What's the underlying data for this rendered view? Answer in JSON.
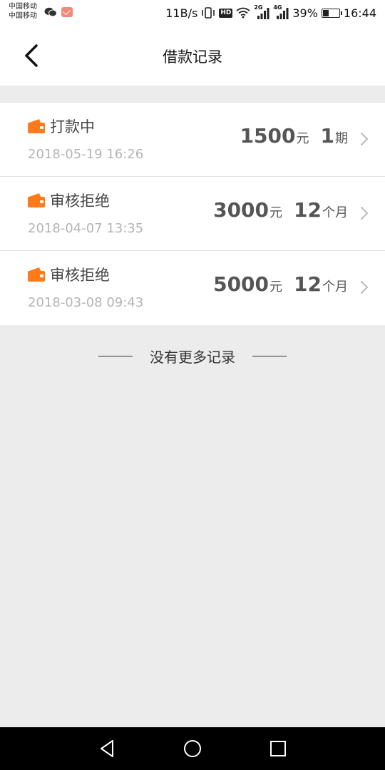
{
  "status_bar": {
    "carrier_1": "中国移动",
    "carrier_2": "中国移动",
    "speed": "11B/s",
    "hd": "HD",
    "net_2g": "2G",
    "net_4g": "4G",
    "battery_percent": "39%",
    "battery_level": 0.39,
    "time": "16:44"
  },
  "header": {
    "title": "借款记录"
  },
  "records": [
    {
      "status": "打款中",
      "date": "2018-05-19 16:26",
      "amount": "1500",
      "amount_unit": "元",
      "term": "1",
      "term_unit": "期"
    },
    {
      "status": "审核拒绝",
      "date": "2018-04-07 13:35",
      "amount": "3000",
      "amount_unit": "元",
      "term": "12",
      "term_unit": "个月"
    },
    {
      "status": "审核拒绝",
      "date": "2018-03-08 09:43",
      "amount": "5000",
      "amount_unit": "元",
      "term": "12",
      "term_unit": "个月"
    }
  ],
  "footer": {
    "no_more_text": "没有更多记录"
  },
  "colors": {
    "accent": "#ff7a1a",
    "background": "#ececec"
  }
}
